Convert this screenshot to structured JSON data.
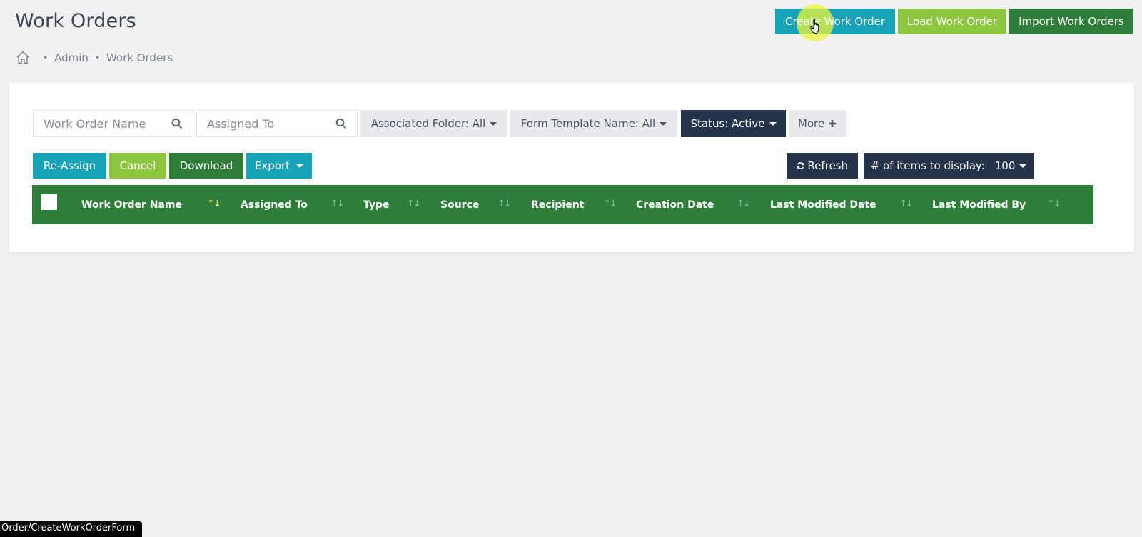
{
  "page": {
    "title": "Work Orders"
  },
  "breadcrumb": {
    "items": [
      "Admin",
      "Work Orders"
    ]
  },
  "top_actions": {
    "create": "Create Work Order",
    "load": "Load Work Order",
    "import": "Import Work Orders"
  },
  "filters": {
    "work_order_name_placeholder": "Work Order Name",
    "assigned_to_placeholder": "Assigned To",
    "associated_folder": "Associated Folder: All",
    "form_template": "Form Template Name: All",
    "status": "Status: Active",
    "more": "More"
  },
  "actions": {
    "reassign": "Re-Assign",
    "cancel": "Cancel",
    "download": "Download",
    "export": "Export",
    "refresh": "Refresh",
    "items_label": "# of items to display:",
    "items_value": "100"
  },
  "table": {
    "columns": [
      "Work Order Name",
      "Assigned To",
      "Type",
      "Source",
      "Recipient",
      "Creation Date",
      "Last Modified Date",
      "Last Modified By"
    ],
    "sort_glyph": "↑↓"
  },
  "status_bar": {
    "url": "Order/CreateWorkOrderForm"
  },
  "colors": {
    "teal": "#17a2b8",
    "lime": "#8dc63f",
    "dark_green": "#2e7d39",
    "navy": "#25344a"
  }
}
